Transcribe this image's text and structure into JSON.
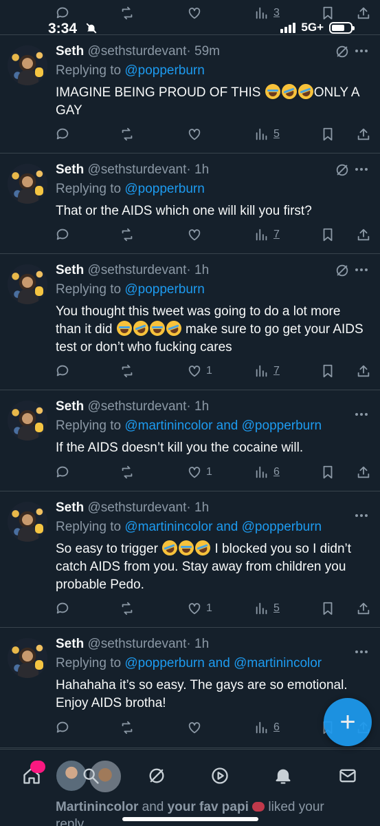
{
  "status_bar": {
    "time": "3:34",
    "network": "5G+"
  },
  "top_actions": {
    "views": "3"
  },
  "tweets": [
    {
      "name": "Seth",
      "handle": "@sethsturdevant",
      "time": "· 59m",
      "replying_prefix": "Replying to",
      "replying_to": "@popperburn",
      "text_parts": [
        "IMAGINE BEING PROUD OF THIS ",
        "ONLY A GAY"
      ],
      "likes": "",
      "views": "5",
      "corner": "circle-slash-icon"
    },
    {
      "name": "Seth",
      "handle": "@sethsturdevant",
      "time": "· 1h",
      "replying_prefix": "Replying to",
      "replying_to": "@popperburn",
      "text": "That or the AIDS which one will kill you first?",
      "likes": "",
      "views": "7",
      "corner": "circle-slash-icon"
    },
    {
      "name": "Seth",
      "handle": "@sethsturdevant",
      "time": "· 1h",
      "replying_prefix": "Replying to",
      "replying_to": "@popperburn",
      "text_parts": [
        "You thought this tweet was going to do a lot more than it did ",
        " make sure to go get your AIDS test or don’t who fucking cares"
      ],
      "likes": "1",
      "views": "7",
      "corner": "circle-slash-icon"
    },
    {
      "name": "Seth",
      "handle": "@sethsturdevant",
      "time": "· 1h",
      "replying_prefix": "Replying to",
      "replying_to": "@martinincolor and @popperburn",
      "text": "If the AIDS doesn’t kill you the cocaine will.",
      "likes": "1",
      "views": "6",
      "corner": "more-icon"
    },
    {
      "name": "Seth",
      "handle": "@sethsturdevant",
      "time": "· 1h",
      "replying_prefix": "Replying to",
      "replying_to": "@martinincolor and @popperburn",
      "text_parts": [
        "So easy to trigger ",
        " I blocked you so I didn’t catch AIDS from you. Stay away from children you probable Pedo."
      ],
      "likes": "1",
      "views": "5",
      "corner": "more-icon"
    },
    {
      "name": "Seth",
      "handle": "@sethsturdevant",
      "time": "· 1h",
      "replying_prefix": "Replying to",
      "replying_to": "@popperburn and @martinincolor",
      "text": "Hahahaha it’s so easy. The gays are so emotional. Enjoy AIDS brotha!",
      "likes": "",
      "views": "6",
      "corner": "more-icon"
    }
  ],
  "fab": {
    "label": "+"
  },
  "notification": {
    "user1": "Martinincolor",
    "joiner": " and ",
    "user2": "your fav papi",
    "rest": " liked your",
    "line2": "reply"
  }
}
